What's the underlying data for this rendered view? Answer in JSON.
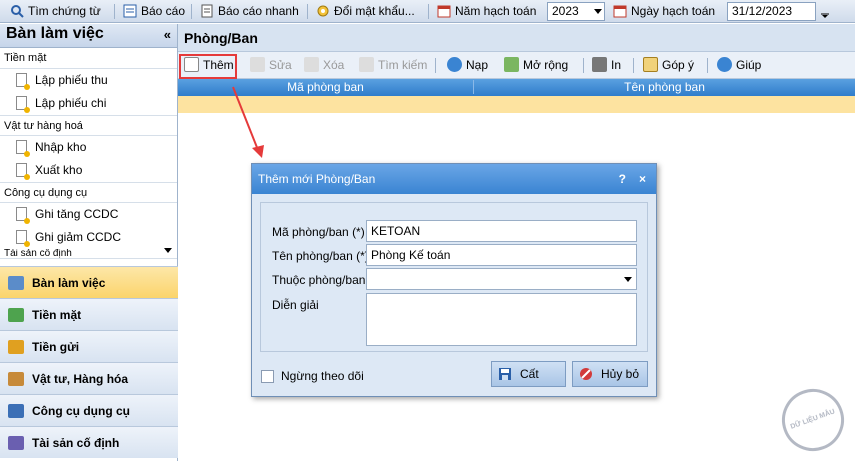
{
  "topbar": {
    "search_label": "Tìm chứng từ",
    "report_label": "Báo cáo",
    "quick_report_label": "Báo cáo nhanh",
    "change_password_label": "Đổi mật khẩu...",
    "fiscal_year_label": "Năm hạch toán",
    "fiscal_year_value": "2023",
    "posting_date_label": "Ngày hạch toán",
    "posting_date_value": "31/12/2023"
  },
  "sidebar": {
    "title": "Bàn làm việc",
    "collapse_glyph": "«",
    "groups": [
      {
        "label": "Tiền mặt",
        "items": [
          "Lập phiếu thu",
          "Lập phiếu chi"
        ]
      },
      {
        "label": "Vật tư hàng hoá",
        "items": [
          "Nhập kho",
          "Xuất kho"
        ]
      },
      {
        "label": "Công cụ dụng cụ",
        "items": [
          "Ghi tăng CCDC",
          "Ghi giảm CCDC"
        ]
      },
      {
        "label": "Tài sản cố định",
        "items": []
      }
    ],
    "nav": [
      {
        "label": "Bàn làm việc",
        "icon": "desk-icon"
      },
      {
        "label": "Tiền mặt",
        "icon": "cash-icon"
      },
      {
        "label": "Tiền gửi",
        "icon": "deposit-icon"
      },
      {
        "label": "Vật tư, Hàng hóa",
        "icon": "goods-icon"
      },
      {
        "label": "Công cụ dụng cụ",
        "icon": "tools-icon"
      },
      {
        "label": "Tài sản cố định",
        "icon": "asset-icon"
      }
    ]
  },
  "main": {
    "title": "Phòng/Ban",
    "toolbar": {
      "add": "Thêm",
      "edit": "Sửa",
      "delete": "Xóa",
      "find": "Tìm kiếm",
      "reload": "Nạp",
      "expand": "Mở rộng",
      "print": "In",
      "feedback": "Góp ý",
      "help": "Giúp"
    },
    "columns": [
      "Mã phòng ban",
      "Tên phòng ban"
    ]
  },
  "dialog": {
    "title": "Thêm mới Phòng/Ban",
    "help_glyph": "?",
    "close_glyph": "×",
    "code_label": "Mã phòng/ban (*)",
    "code_value": "KETOAN",
    "name_label": "Tên phòng/ban (*)",
    "name_value": "Phòng Kế toán",
    "parent_label": "Thuộc phòng/ban",
    "parent_value": "",
    "desc_label": "Diễn giải",
    "inactive_label": "Ngừng theo dõi",
    "save_label": "Cất",
    "cancel_label": "Hủy bỏ"
  },
  "watermark": "DỮ LIỆU MẪU",
  "colors": {
    "highlight": "#e53a3a",
    "accent": "#3a84d2",
    "active_nav": "#fbd46b"
  }
}
